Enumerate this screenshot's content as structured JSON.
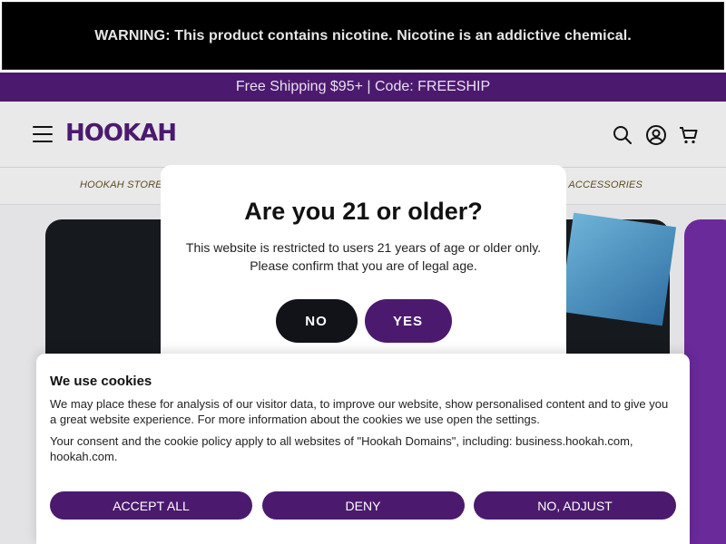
{
  "warning": {
    "text": "WARNING: This product contains nicotine. Nicotine is an addictive chemical."
  },
  "promo": {
    "text": "Free Shipping $95+ | Code: FREESHIP"
  },
  "header": {
    "logo": "HOOKAH",
    "icons": [
      "menu-icon",
      "search-icon",
      "account-icon",
      "cart-icon"
    ]
  },
  "nav": {
    "items": [
      {
        "label": "HOOKAH STORE"
      },
      {
        "label": "& ACCESSORIES"
      }
    ]
  },
  "age_gate": {
    "title": "Are you 21 or older?",
    "text": "This website is restricted to users 21 years of age or older only. Please confirm that you are of legal age.",
    "no_label": "NO",
    "yes_label": "YES"
  },
  "cookies": {
    "title": "We use cookies",
    "text1": "We may place these for analysis of our visitor data, to improve our website, show personalised content and to give you a great website experience. For more information about the cookies we use open the settings.",
    "text2": "Your consent and the cookie policy apply to all websites of \"Hookah Domains\", including: business.hookah.com, hookah.com.",
    "accept_label": "ACCEPT ALL",
    "deny_label": "DENY",
    "adjust_label": "NO, ADJUST"
  },
  "colors": {
    "brand": "#4b1a6e",
    "dark": "#111318"
  }
}
